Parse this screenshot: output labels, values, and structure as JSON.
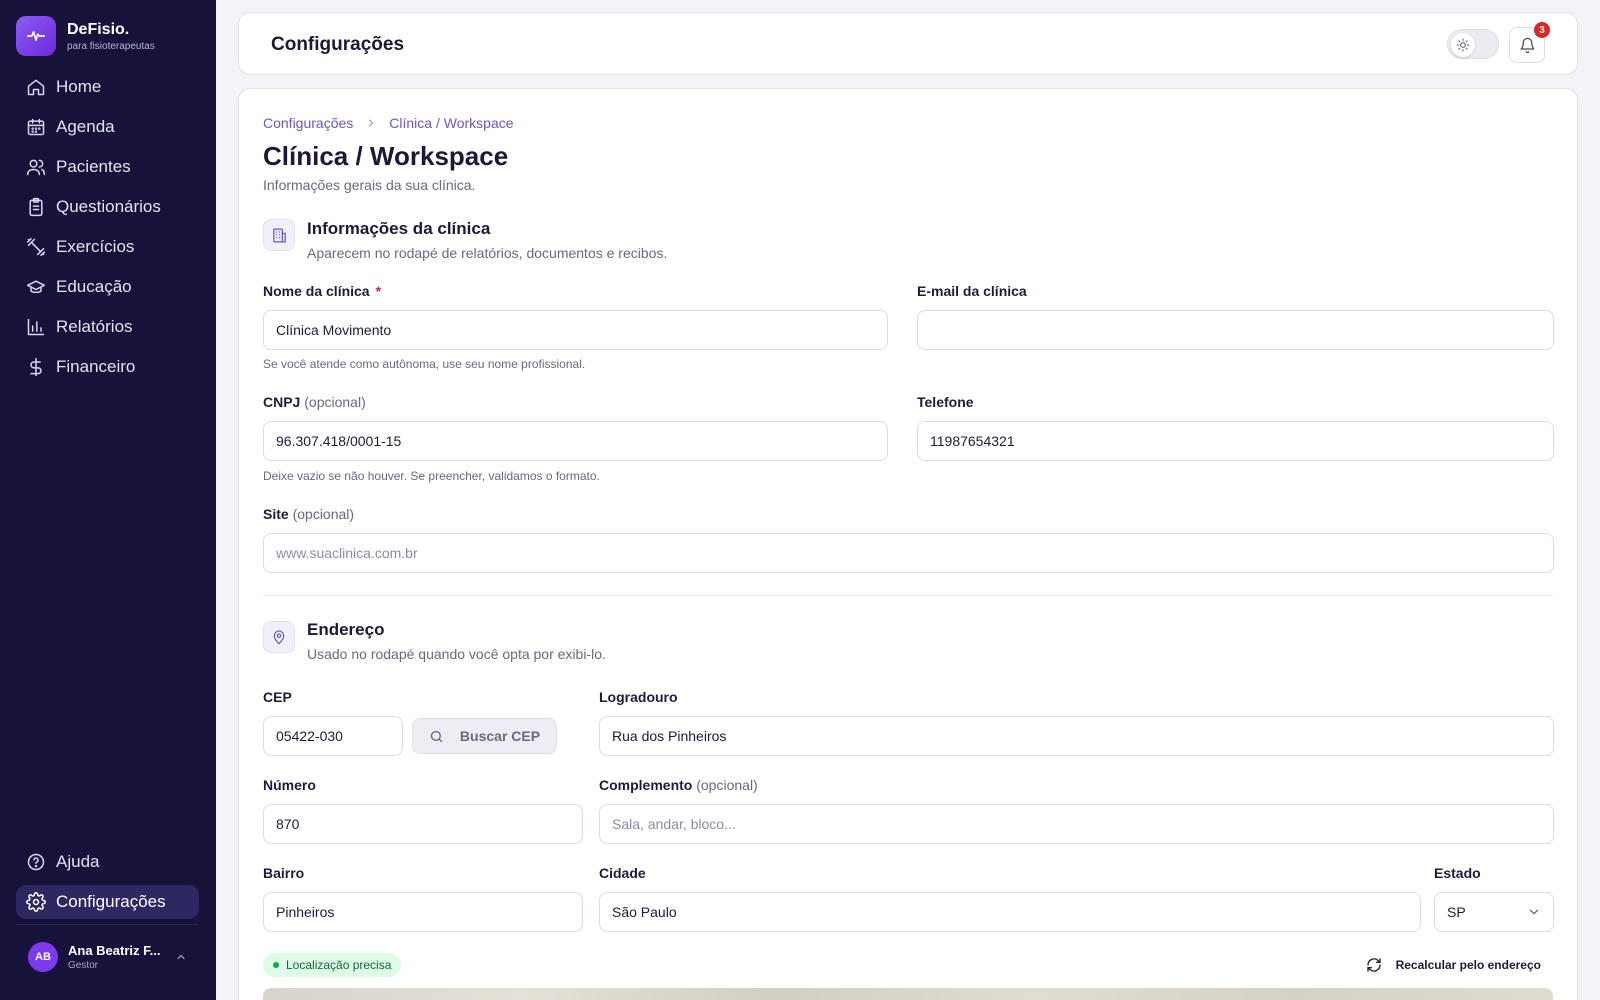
{
  "brand": {
    "name": "DeFisio.",
    "tagline": "para fisioterapeutas"
  },
  "sidebar": {
    "items": [
      {
        "label": "Home",
        "icon": "home-icon"
      },
      {
        "label": "Agenda",
        "icon": "calendar-icon"
      },
      {
        "label": "Pacientes",
        "icon": "users-icon"
      },
      {
        "label": "Questionários",
        "icon": "clipboard-icon"
      },
      {
        "label": "Exercícios",
        "icon": "dumbbell-icon"
      },
      {
        "label": "Educação",
        "icon": "graduation-cap-icon"
      },
      {
        "label": "Relatórios",
        "icon": "bar-chart-icon"
      },
      {
        "label": "Financeiro",
        "icon": "dollar-icon"
      }
    ],
    "help_label": "Ajuda",
    "settings_label": "Configurações"
  },
  "user": {
    "initials": "AB",
    "name": "Ana Beatriz F...",
    "role": "Gestor"
  },
  "header": {
    "title": "Configurações",
    "notification_count": "3"
  },
  "breadcrumb": {
    "root": "Configurações",
    "current": "Clínica / Workspace"
  },
  "page": {
    "title": "Clínica / Workspace",
    "subtitle": "Informações gerais da sua clínica."
  },
  "clinic_info": {
    "title": "Informações da clínica",
    "subtitle": "Aparecem no rodapé de relatórios, documentos e recibos.",
    "name_label": "Nome da clínica",
    "required_mark": "*",
    "name_value": "Clínica Movimento",
    "name_hint": "Se você atende como autônoma, use seu nome profissional.",
    "email_label": "E-mail da clínica",
    "email_value": "",
    "cnpj_label": "CNPJ",
    "optional_text": "(opcional)",
    "cnpj_value": "96.307.418/0001-15",
    "cnpj_hint": "Deixe vazio se não houver. Se preencher, validamos o formato.",
    "phone_label": "Telefone",
    "phone_value": "11987654321",
    "site_label": "Site",
    "site_placeholder": "www.suaclinica.com.br"
  },
  "address": {
    "title": "Endereço",
    "subtitle": "Usado no rodapé quando você opta por exibi-lo.",
    "cep_label": "CEP",
    "cep_value": "05422-030",
    "cep_button": "Buscar CEP",
    "street_label": "Logradouro",
    "street_value": "Rua dos Pinheiros",
    "number_label": "Número",
    "number_value": "870",
    "complement_label": "Complemento",
    "complement_placeholder": "Sala, andar, bloco...",
    "district_label": "Bairro",
    "district_value": "Pinheiros",
    "city_label": "Cidade",
    "city_value": "São Paulo",
    "state_label": "Estado",
    "state_value": "SP",
    "location_badge": "Localização precisa",
    "recalc_button": "Recalcular pelo endereço"
  }
}
